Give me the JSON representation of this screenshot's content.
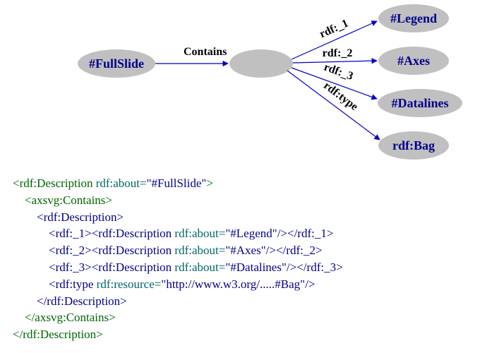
{
  "graph": {
    "nodes": {
      "fullslide": "#FullSlide",
      "legend": "#Legend",
      "axes": "#Axes",
      "datalines": "#Datalines",
      "bag": "rdf:Bag"
    },
    "edges": {
      "contains": "Contains",
      "r1": "rdf:_1",
      "r2": "rdf:_2",
      "r3": "rdf:_3",
      "rtype": "rdf:type"
    }
  },
  "code": {
    "l1a": "<rdf:Description",
    "l1b": " rdf:about=",
    "l1c": "\"#FullSlide\"",
    "l1d": ">",
    "l2": "    <axsvg:Contains>",
    "l3": "        <rdf:Description>",
    "l4a": "            <rdf:_1><rdf:Description",
    "l4b": " rdf:about=",
    "l4c": "\"#Legend\"",
    "l4d": "/></rdf:_1>",
    "l5a": "            <rdf:_2><rdf:Description",
    "l5b": " rdf:about=",
    "l5c": "\"#Axes\"",
    "l5d": "/></rdf:_2>",
    "l6a": "            <rdf:_3><rdf:Description",
    "l6b": " rdf:about=",
    "l6c": "\"#Datalines\"",
    "l6d": "/></rdf:_3>",
    "l7a": "            <rdf:type",
    "l7b": " rdf:resource=",
    "l7c": "\"http://www.w3.org/.....#Bag\"",
    "l7d": "/>",
    "l8": "        </rdf:Description>",
    "l9": "    </axsvg:Contains>",
    "l10": "</rdf:Description>"
  }
}
